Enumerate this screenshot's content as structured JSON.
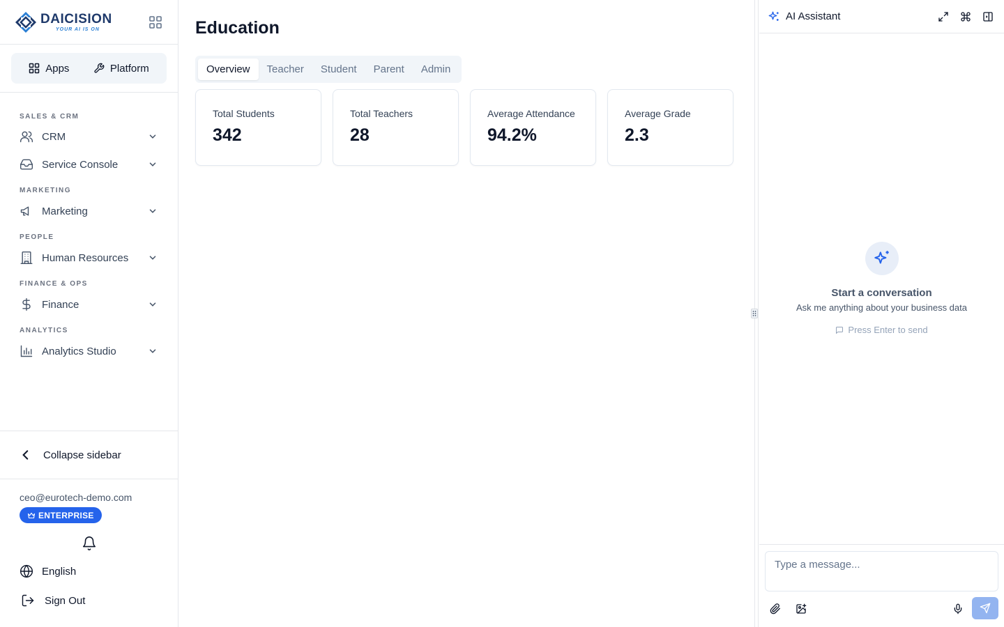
{
  "brand": {
    "name": "DAICISION",
    "tagline": "YOUR AI IS ON"
  },
  "switcher": {
    "apps_label": "Apps",
    "platform_label": "Platform"
  },
  "sidebar": {
    "sections": [
      {
        "label": "SALES & CRM",
        "items": [
          {
            "label": "CRM",
            "icon": "users-icon"
          },
          {
            "label": "Service Console",
            "icon": "inbox-icon"
          }
        ]
      },
      {
        "label": "MARKETING",
        "items": [
          {
            "label": "Marketing",
            "icon": "megaphone-icon"
          }
        ]
      },
      {
        "label": "PEOPLE",
        "items": [
          {
            "label": "Human Resources",
            "icon": "building-icon"
          }
        ]
      },
      {
        "label": "FINANCE & OPS",
        "items": [
          {
            "label": "Finance",
            "icon": "dollar-icon"
          }
        ]
      },
      {
        "label": "ANALYTICS",
        "items": [
          {
            "label": "Analytics Studio",
            "icon": "bar-chart-icon"
          }
        ]
      }
    ],
    "collapse_label": "Collapse sidebar"
  },
  "user": {
    "email": "ceo@eurotech-demo.com",
    "plan": "ENTERPRISE",
    "language": "English",
    "signout_label": "Sign Out"
  },
  "page": {
    "title": "Education",
    "tabs": [
      {
        "label": "Overview"
      },
      {
        "label": "Teacher"
      },
      {
        "label": "Student"
      },
      {
        "label": "Parent"
      },
      {
        "label": "Admin"
      }
    ],
    "active_tab": "Overview",
    "stats": [
      {
        "label": "Total Students",
        "value": "342"
      },
      {
        "label": "Total Teachers",
        "value": "28"
      },
      {
        "label": "Average Attendance",
        "value": "94.2%"
      },
      {
        "label": "Average Grade",
        "value": "2.3"
      }
    ]
  },
  "assistant": {
    "title": "AI Assistant",
    "empty_title": "Start a conversation",
    "empty_subtitle": "Ask me anything about your business data",
    "hint": "Press Enter to send",
    "placeholder": "Type a message..."
  },
  "colors": {
    "accent": "#2563eb",
    "send_disabled": "#93b4f0"
  }
}
